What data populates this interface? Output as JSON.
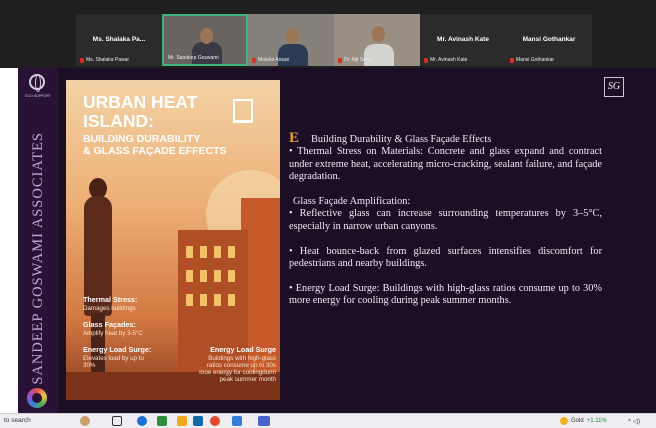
{
  "participants": [
    {
      "name": "Ms. Shalaka Pa...",
      "tag": "Ms. Shalaka Pawar",
      "video": false
    },
    {
      "name": "",
      "tag": "Mr. Sandeep Goswami",
      "video": true,
      "active": true
    },
    {
      "name": "",
      "tag": "Maleka Ansari",
      "video": true
    },
    {
      "name": "",
      "tag": "Dr. Ajit Salvi",
      "video": true
    },
    {
      "name": "Mr. Avinash Kate",
      "tag": "Mr. Avinash Kate",
      "video": false
    },
    {
      "name": "Mansi Gothankar",
      "tag": "Mansi Gothankar",
      "video": false
    }
  ],
  "sidebar": {
    "vertical_text": "SANDEEP GOSWAMI ASSOCIATES",
    "eco_label": "ECO SUPPORT"
  },
  "poster": {
    "title_line1": "URBAN HEAT",
    "title_line2": "ISLAND:",
    "subtitle_line1": "BUILDING DURABILITY",
    "subtitle_line2": "& GLASS FAÇADE EFFECTS",
    "thermal_label": "Thermal Stress:",
    "thermal_text": "Damages buildings",
    "glass_label": "Glass Façades:",
    "glass_text": "Amplify heat by 3-5°C",
    "energy_label": "Energy Load Surge:",
    "energy_text_line1": "Elevates load by up to",
    "energy_text_line2": "30%",
    "energy2_label": "Energy Load Surge",
    "energy2_line1": "Buildings with high-glass",
    "energy2_line2": "ratios consume up to 30s",
    "energy2_line3": "moe energy for coolingdurin",
    "energy2_line4": "peak summer month"
  },
  "logo_text": "SG",
  "content": {
    "heading_cap": "E",
    "heading": "Building Durability & Glass Façade Effects",
    "thermal": "• Thermal Stress on Materials: Concrete and glass expand and contract under extreme heat, accelerating micro-cracking, sealant failure, and façade degradation.",
    "glass_heading": "Glass Façade Amplification:",
    "glass": "• Reflective glass can increase surrounding temperatures by 3–5°C, especially in narrow urban canyons.",
    "bounce": "• Heat bounce-back from glazed surfaces intensifies discomfort for pedestrians and nearby buildings.",
    "energy": "• Energy Load Surge: Buildings with high-glass ratios consume up to 30% more energy for cooling during peak summer months."
  },
  "taskbar": {
    "search_text": "to search",
    "stock_name": "Gold",
    "stock_change": "+1.11%",
    "app_colors": [
      "#1f6fd6",
      "#2b8c3e",
      "#f2a81d",
      "#0b6aa8",
      "#e24a2b",
      "#2f7fd8",
      "#4763cc"
    ]
  }
}
